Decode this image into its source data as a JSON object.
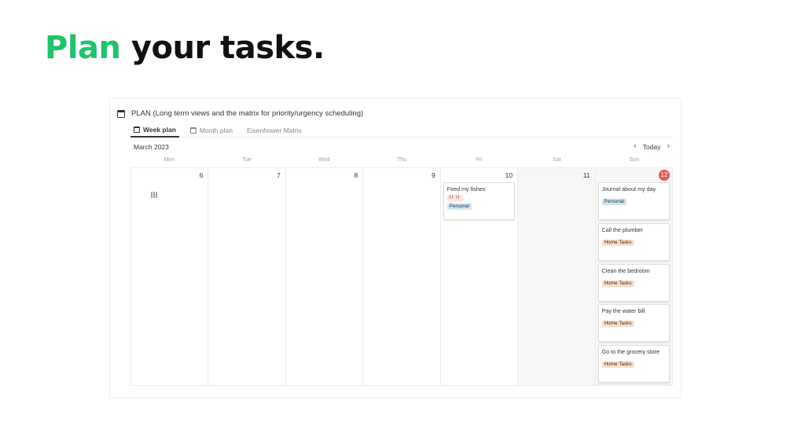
{
  "headline": {
    "accent": "Plan",
    "rest": " your tasks."
  },
  "database": {
    "title": "PLAN (Long term views and the matrix for priority/urgency scheduling)",
    "tabs": [
      {
        "label": "Week plan",
        "icon": "calendar-icon",
        "active": true
      },
      {
        "label": "Month plan",
        "icon": "calendar-icon",
        "active": false
      },
      {
        "label": "Eisenhower Matrix",
        "icon": "table-icon",
        "active": false
      }
    ]
  },
  "calendar": {
    "month": "March 2023",
    "today_label": "Today",
    "weekdays": [
      "Mon",
      "Tue",
      "Wed",
      "Thu",
      "Fri",
      "Sat",
      "Sun"
    ],
    "days": [
      "6",
      "7",
      "8",
      "9",
      "10",
      "11",
      "12"
    ],
    "today_index": 6,
    "fri_events": [
      {
        "title": "Feed my fishes",
        "priority": "!! !!",
        "tag": "Personal"
      }
    ],
    "sun_events": [
      {
        "title": "Journal about my day",
        "tag": "Personal"
      },
      {
        "title": "Call the plumber",
        "tag": "Home Tasks"
      },
      {
        "title": "Clean the bedroom",
        "tag": "Home Tasks"
      },
      {
        "title": "Pay the water bill",
        "tag": "Home Tasks"
      },
      {
        "title": "Go to the grocery store",
        "tag": "Home Tasks"
      }
    ]
  },
  "colors": {
    "accent_green": "#1ec46b",
    "today_red": "#eb5757",
    "tag_personal": "#d3e5ef",
    "tag_home": "#fadec9",
    "tag_priority": "#ffe2dd"
  }
}
